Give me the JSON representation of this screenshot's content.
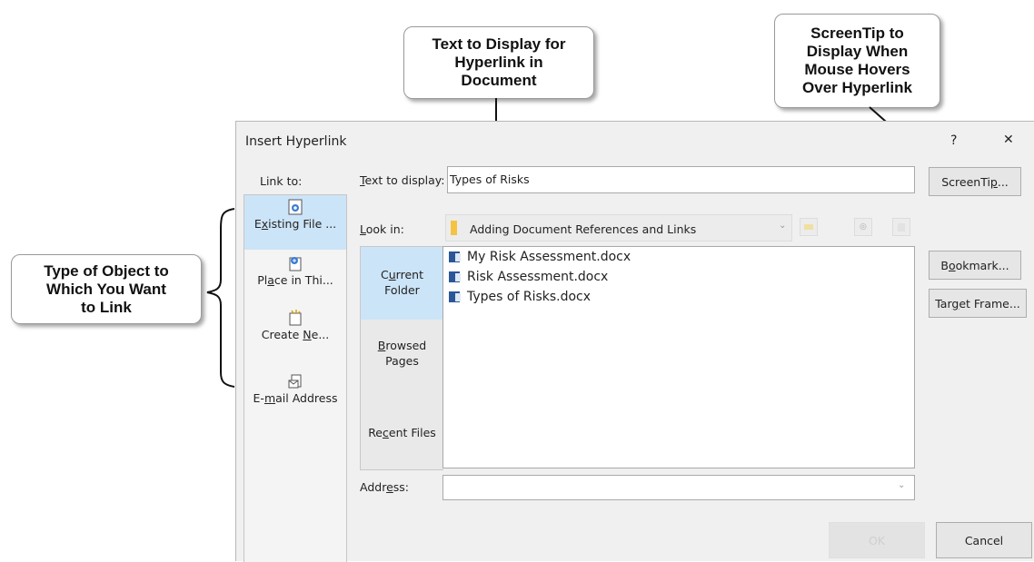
{
  "callouts": {
    "text_display": "Text to Display for\nHyperlink in\nDocument",
    "screentip": "ScreenTip to\nDisplay When\nMouse Hovers\nOver Hyperlink",
    "object_type": "Type of Object to\nWhich You Want\nto Link"
  },
  "dialog": {
    "title": "Insert Hyperlink",
    "help": "?",
    "close": "✕",
    "link_to_label": "Link to:",
    "link_to_items": [
      {
        "pre": "E",
        "key": "x",
        "post": "isting File ...",
        "icon": "existing-file-icon"
      },
      {
        "pre": "Pl",
        "key": "a",
        "post": "ce in Thi...",
        "icon": "place-in-document-icon"
      },
      {
        "pre": "Create ",
        "key": "N",
        "post": "e...",
        "icon": "create-new-icon"
      },
      {
        "pre": "E-",
        "key": "m",
        "post": "ail Address",
        "icon": "email-address-icon"
      }
    ],
    "text_to_display_label_key": "T",
    "text_to_display_label_rest": "ext to display:",
    "text_to_display_value": "Types of Risks",
    "screentip_button": {
      "pre": "ScreenTi",
      "key": "p",
      "post": "..."
    },
    "look_in_label_key": "L",
    "look_in_label_rest": "ook in:",
    "look_in_value": "Adding Document References and Links",
    "current_folder": {
      "pre": "C",
      "key": "u",
      "post": "rrent\nFolder"
    },
    "browsed_pages": {
      "pre": "",
      "key": "B",
      "post": "rowsed\nPages"
    },
    "recent_files": {
      "pre": "Re",
      "key": "c",
      "post": "ent Files"
    },
    "files": [
      "My Risk Assessment.docx",
      "Risk Assessment.docx",
      "Types of Risks.docx"
    ],
    "bookmark_button": {
      "pre": "B",
      "key": "o",
      "post": "okmark..."
    },
    "target_frame_button": {
      "pre": "Tar",
      "key": "g",
      "post": "et Frame..."
    },
    "address_label_pre": "Addr",
    "address_label_key": "e",
    "address_label_post": "ss:",
    "address_value": "",
    "ok_button": "OK",
    "cancel_button": "Cancel"
  },
  "colors": {
    "selected": "#cce4f7",
    "folder": "#f5c342",
    "word_icon": "#2b5797"
  }
}
